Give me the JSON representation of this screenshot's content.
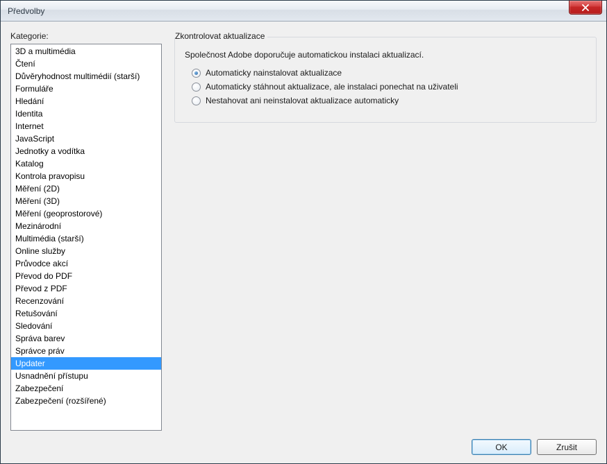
{
  "window": {
    "title": "Předvolby"
  },
  "left": {
    "label": "Kategorie:",
    "items": [
      "3D a multimédia",
      "Čtení",
      "Důvěryhodnost multimédií (starší)",
      "Formuláře",
      "Hledání",
      "Identita",
      "Internet",
      "JavaScript",
      "Jednotky a vodítka",
      "Katalog",
      "Kontrola pravopisu",
      "Měření (2D)",
      "Měření (3D)",
      "Měření (geoprostorové)",
      "Mezinárodní",
      "Multimédia (starší)",
      "Online služby",
      "Průvodce akcí",
      "Převod do PDF",
      "Převod z PDF",
      "Recenzování",
      "Retušování",
      "Sledování",
      "Správa barev",
      "Správce práv",
      "Updater",
      "Usnadnění přístupu",
      "Zabezpečení",
      "Zabezpečení (rozšířené)"
    ],
    "selectedIndex": 25
  },
  "panel": {
    "groupTitle": "Zkontrolovat aktualizace",
    "description": "Společnost Adobe doporučuje automatickou instalaci aktualizací.",
    "options": [
      {
        "label": "Automaticky nainstalovat aktualizace",
        "checked": true
      },
      {
        "label": "Automaticky stáhnout aktualizace, ale instalaci ponechat na uživateli",
        "checked": false
      },
      {
        "label": "Nestahovat ani neinstalovat aktualizace automaticky",
        "checked": false
      }
    ]
  },
  "buttons": {
    "ok": "OK",
    "cancel": "Zrušit"
  }
}
